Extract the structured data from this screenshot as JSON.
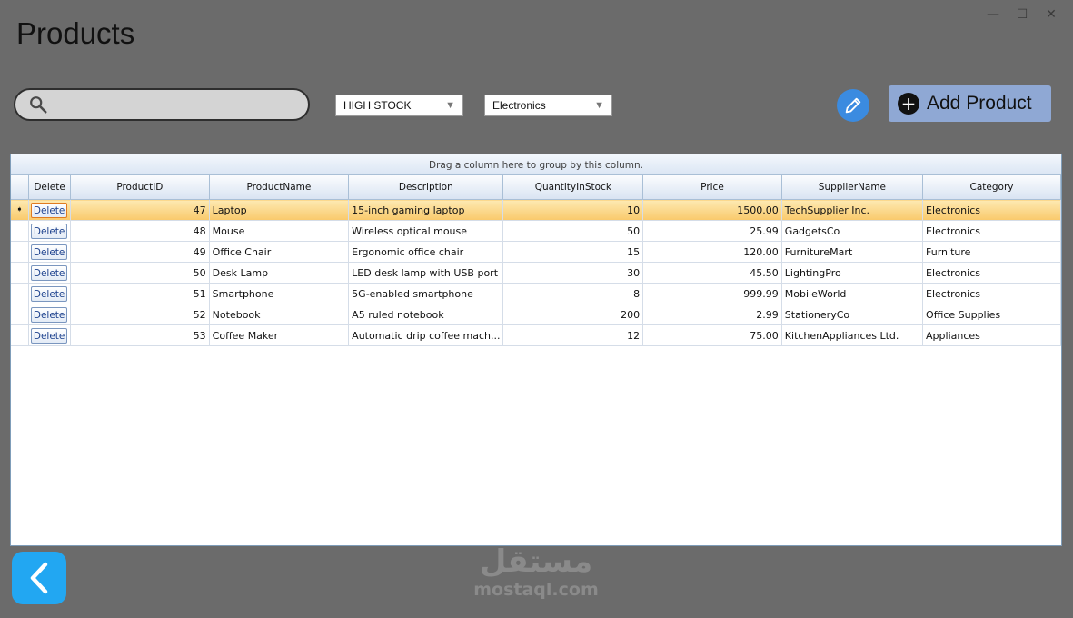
{
  "window": {
    "title": "Products",
    "controls": {
      "minimize": "—",
      "maximize": "☐",
      "close": "✕"
    }
  },
  "toolbar": {
    "search_placeholder": "",
    "stock_filter": "HIGH STOCK",
    "category_filter": "Electronics",
    "add_label": "Add Product",
    "add_icon": "+"
  },
  "grid": {
    "group_panel_text": "Drag a column here to group by this column.",
    "columns": [
      "Delete",
      "ProductID",
      "ProductName",
      "Description",
      "QuantityInStock",
      "Price",
      "SupplierName",
      "Category"
    ],
    "delete_label": "Delete",
    "current_row_marker": "➧",
    "rows": [
      {
        "id": "47",
        "name": "Laptop",
        "description": "15-inch gaming laptop",
        "qty": "10",
        "price": "1500.00",
        "supplier": "TechSupplier Inc.",
        "category": "Electronics"
      },
      {
        "id": "48",
        "name": "Mouse",
        "description": "Wireless optical mouse",
        "qty": "50",
        "price": "25.99",
        "supplier": "GadgetsCo",
        "category": "Electronics"
      },
      {
        "id": "49",
        "name": "Office Chair",
        "description": "Ergonomic office chair",
        "qty": "15",
        "price": "120.00",
        "supplier": "FurnitureMart",
        "category": "Furniture"
      },
      {
        "id": "50",
        "name": "Desk Lamp",
        "description": "LED desk lamp with USB port",
        "qty": "30",
        "price": "45.50",
        "supplier": "LightingPro",
        "category": "Electronics"
      },
      {
        "id": "51",
        "name": "Smartphone",
        "description": "5G-enabled smartphone",
        "qty": "8",
        "price": "999.99",
        "supplier": "MobileWorld",
        "category": "Electronics"
      },
      {
        "id": "52",
        "name": "Notebook",
        "description": "A5 ruled notebook",
        "qty": "200",
        "price": "2.99",
        "supplier": "StationeryCo",
        "category": "Office Supplies"
      },
      {
        "id": "53",
        "name": "Coffee Maker",
        "description": "Automatic drip coffee mach...",
        "qty": "12",
        "price": "75.00",
        "supplier": "KitchenAppliances Ltd.",
        "category": "Appliances"
      }
    ]
  },
  "watermark": {
    "arabic": "مستقل",
    "latin": "mostaql.com"
  }
}
